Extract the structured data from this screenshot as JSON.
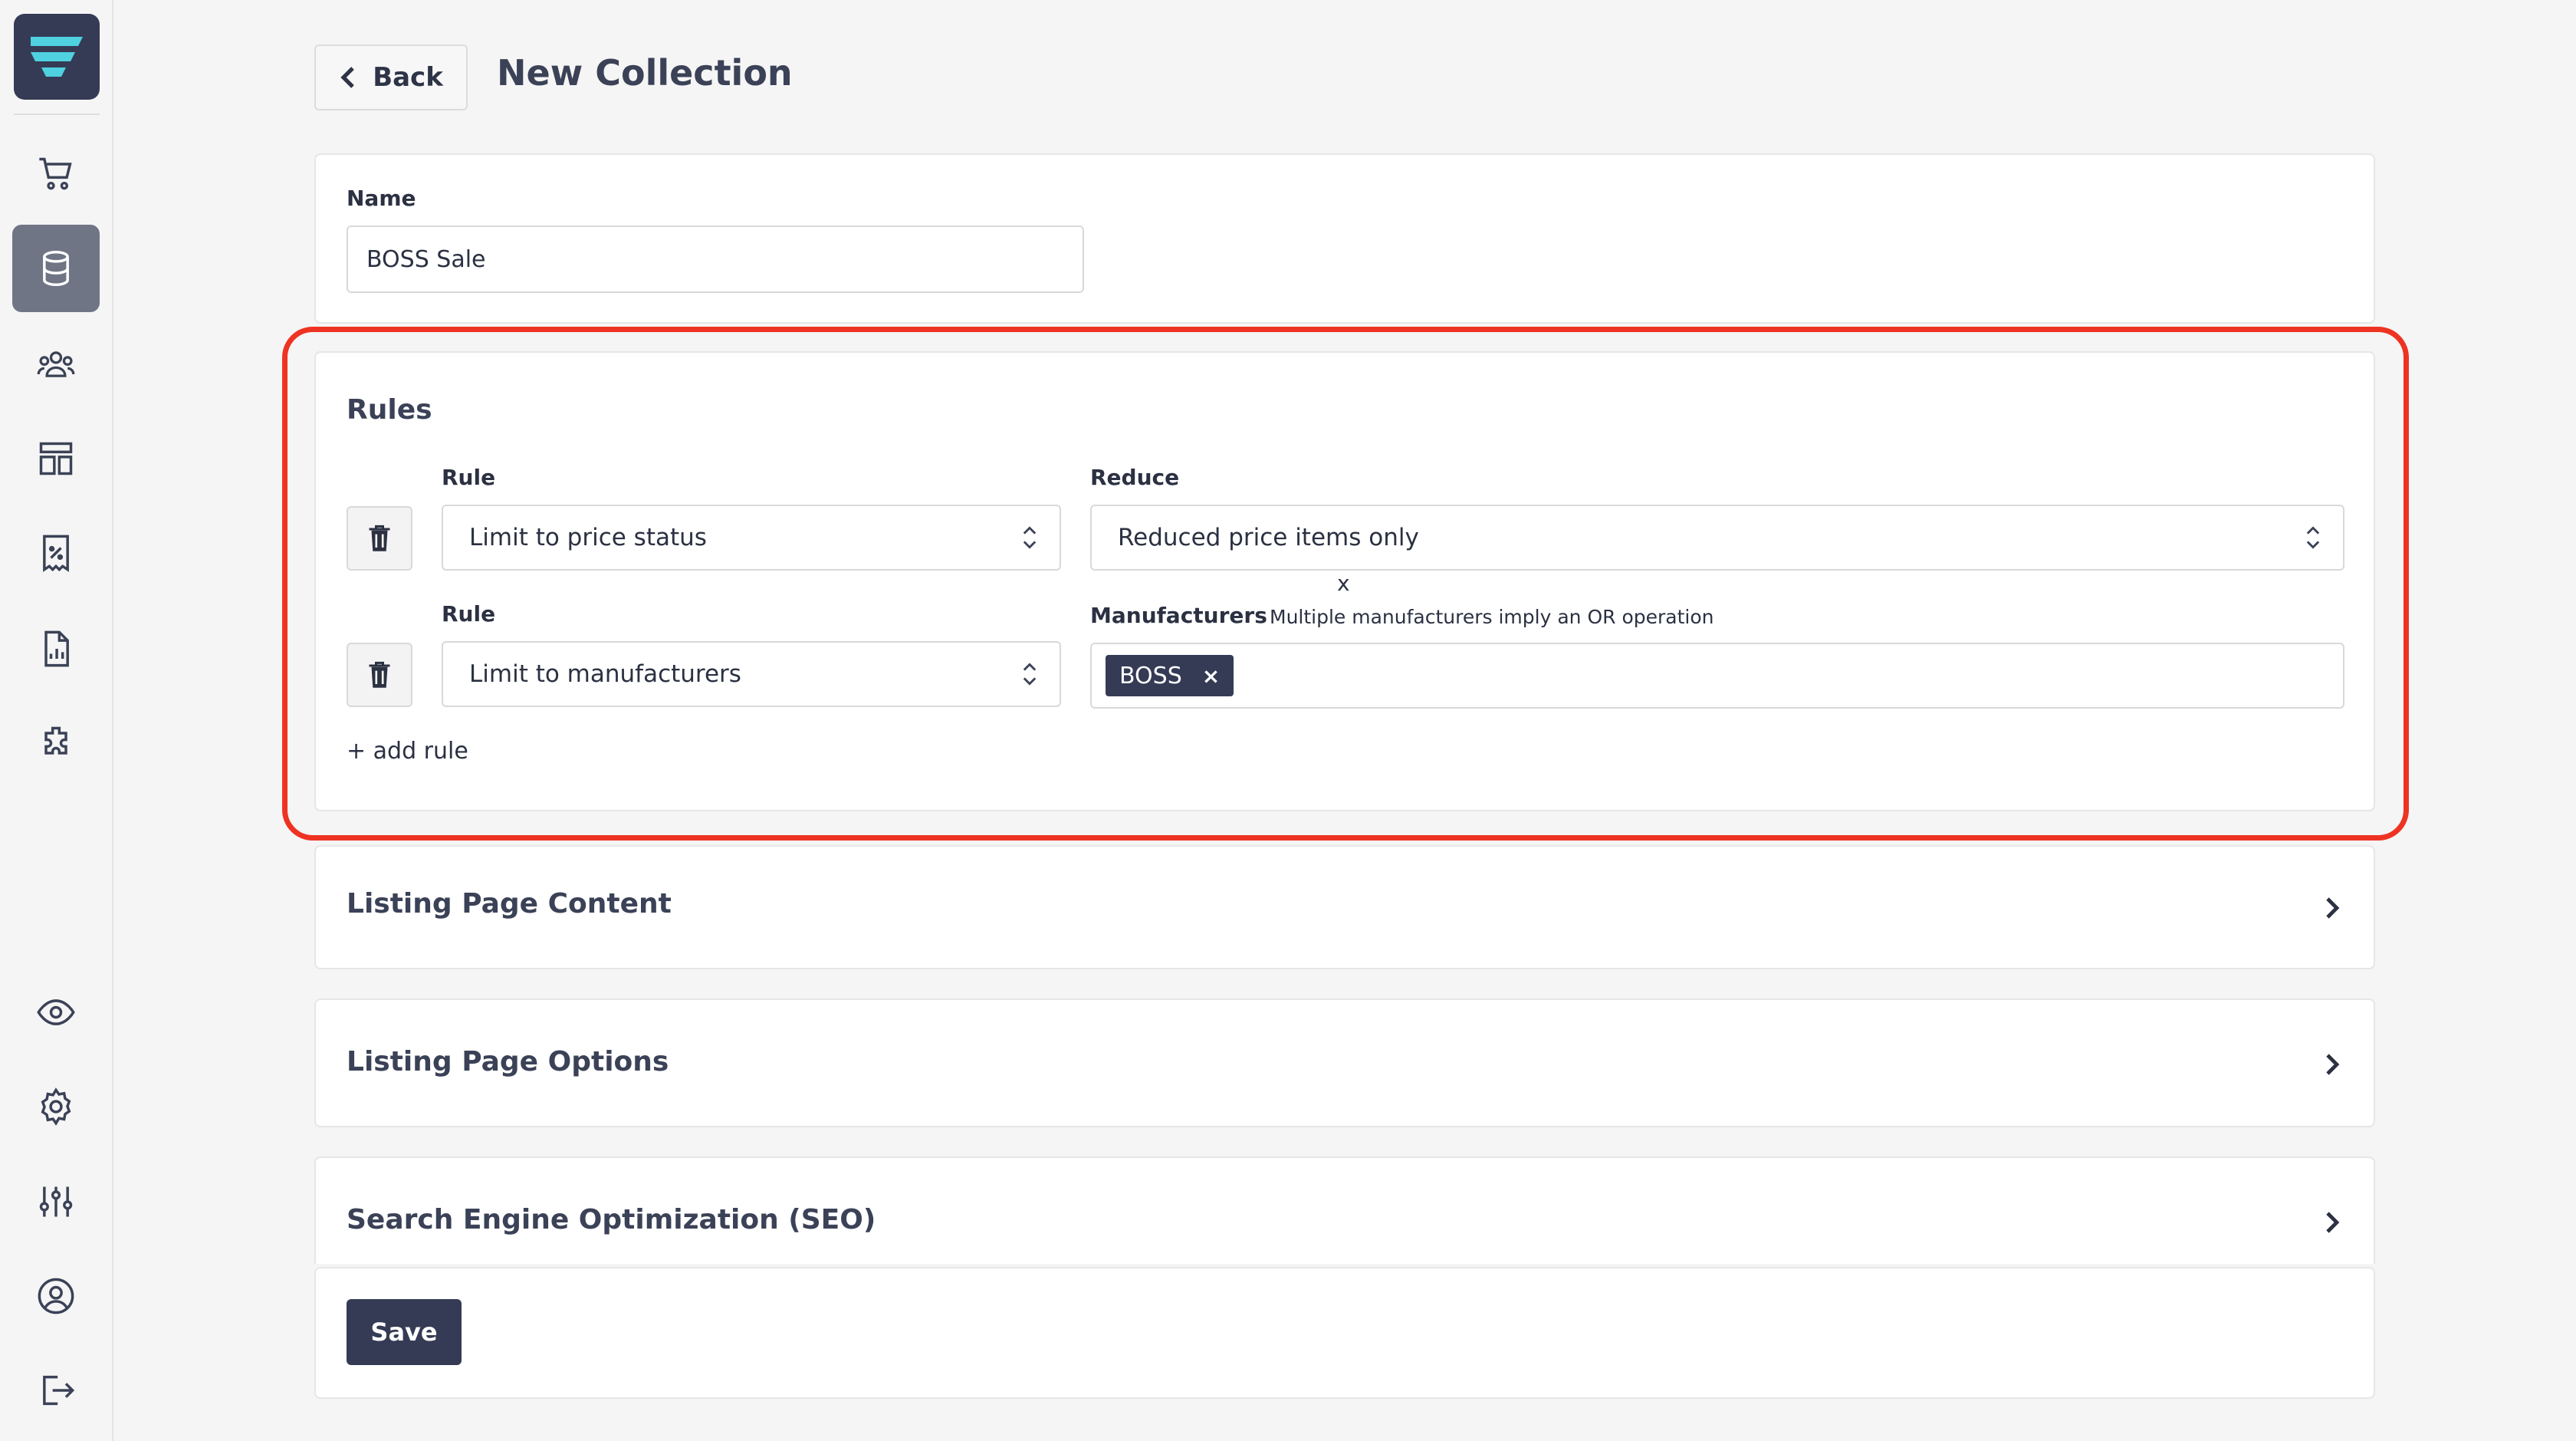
{
  "header": {
    "back_label": "Back",
    "title": "New Collection"
  },
  "sidebar": {
    "logo": "app-logo",
    "items": [
      {
        "icon": "cart-icon",
        "active": false
      },
      {
        "icon": "database-icon",
        "active": true
      },
      {
        "icon": "users-icon",
        "active": false
      },
      {
        "icon": "layout-icon",
        "active": false
      },
      {
        "icon": "receipt-percent-icon",
        "active": false
      },
      {
        "icon": "report-chart-icon",
        "active": false
      },
      {
        "icon": "puzzle-icon",
        "active": false
      },
      {
        "icon": "eye-icon",
        "active": false
      },
      {
        "icon": "gear-icon",
        "active": false
      },
      {
        "icon": "sliders-icon",
        "active": false
      },
      {
        "icon": "user-circle-icon",
        "active": false
      },
      {
        "icon": "logout-icon",
        "active": false
      }
    ]
  },
  "name_section": {
    "label": "Name",
    "value": "BOSS Sale"
  },
  "rules": {
    "title": "Rules",
    "rule_label": "Rule",
    "rows": [
      {
        "rule_value": "Limit to price status",
        "param_label": "Reduce",
        "param_value": "Reduced price items only"
      },
      {
        "rule_value": "Limit to manufacturers",
        "param_label": "Manufacturers",
        "param_hint": "Multiple manufacturers imply an OR operation",
        "tags": [
          "BOSS"
        ]
      }
    ],
    "stray_text": "x",
    "tag_remove": "×",
    "add_rule_label": "+ add rule"
  },
  "sections": [
    {
      "title": "Listing Page Content"
    },
    {
      "title": "Listing Page Options"
    },
    {
      "title": "Search Engine Optimization (SEO)"
    }
  ],
  "footer": {
    "save_label": "Save"
  },
  "colors": {
    "accent": "#353b55",
    "highlight": "#ee3322",
    "background": "#f5f5f5"
  }
}
